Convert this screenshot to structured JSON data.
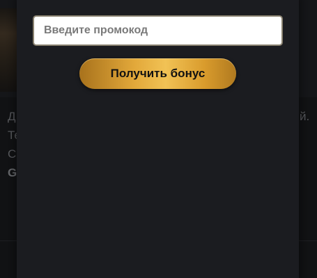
{
  "promo_modal": {
    "input_placeholder": "Введите промокод",
    "input_value": "",
    "submit_label": "Получить бонус"
  },
  "background_page": {
    "text_lines": [
      "Д",
      "Те",
      "С",
      "G"
    ],
    "text_right_fragment": "й."
  },
  "colors": {
    "modal_bg": "#1b1c20",
    "button_gold": "#e2a83a",
    "input_bg": "#ffffff"
  }
}
